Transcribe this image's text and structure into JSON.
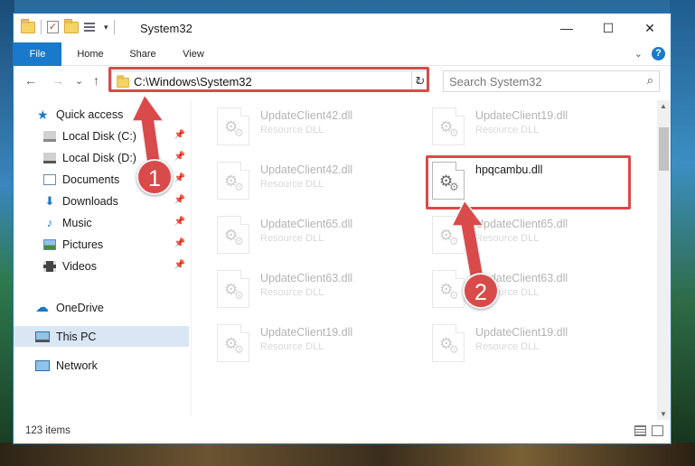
{
  "window": {
    "title": "System32",
    "buttons": {
      "minimize": "—",
      "maximize": "☐",
      "close": "✕"
    }
  },
  "qat": {
    "dropdown": "▾"
  },
  "ribbon": {
    "tabs": [
      "File",
      "Home",
      "Share",
      "View"
    ],
    "expand": "⌄",
    "help": "?"
  },
  "nav": {
    "back": "←",
    "forward": "→",
    "recent": "⌄",
    "up": "↑",
    "address": "C:\\Windows\\System32",
    "address_dropdown": "⌄",
    "refresh": "↻",
    "search_placeholder": "Search System32",
    "search_icon": "search-icon"
  },
  "sidebar": {
    "items": [
      {
        "label": "Quick access",
        "icon": "star-icon",
        "pinned": false,
        "selected": false
      },
      {
        "label": "Local Disk (C:)",
        "icon": "drive-icon",
        "pinned": true,
        "selected": false
      },
      {
        "label": "Local Disk (D:)",
        "icon": "drive-icon",
        "pinned": true,
        "selected": false
      },
      {
        "label": "Documents",
        "icon": "documents-icon",
        "pinned": true,
        "selected": false
      },
      {
        "label": "Downloads",
        "icon": "downloads-icon",
        "pinned": true,
        "selected": false
      },
      {
        "label": "Music",
        "icon": "music-icon",
        "pinned": true,
        "selected": false
      },
      {
        "label": "Pictures",
        "icon": "pictures-icon",
        "pinned": true,
        "selected": false
      },
      {
        "label": "Videos",
        "icon": "videos-icon",
        "pinned": true,
        "selected": false
      },
      {
        "label": "OneDrive",
        "icon": "cloud-icon",
        "pinned": false,
        "selected": false
      },
      {
        "label": "This PC",
        "icon": "computer-icon",
        "pinned": false,
        "selected": true
      },
      {
        "label": "Network",
        "icon": "network-icon",
        "pinned": false,
        "selected": false
      }
    ],
    "pin_glyph": "📌"
  },
  "files": [
    {
      "name": "UpdateClient42.dll",
      "type": "Resource DLL",
      "faded": true
    },
    {
      "name": "UpdateClient19.dll",
      "type": "Resource DLL",
      "faded": true
    },
    {
      "name": "UpdateClient42.dll",
      "type": "Resource DLL",
      "faded": true
    },
    {
      "name": "hpqcambu.dll",
      "type": "",
      "faded": false
    },
    {
      "name": "UpdateClient65.dll",
      "type": "Resource DLL",
      "faded": true
    },
    {
      "name": "UpdateClient65.dll",
      "type": "Resource DLL",
      "faded": true
    },
    {
      "name": "UpdateClient63.dll",
      "type": "Resource DLL",
      "faded": true
    },
    {
      "name": "UpdateClient63.dll",
      "type": "Resource DLL",
      "faded": true
    },
    {
      "name": "UpdateClient19.dll",
      "type": "Resource DLL",
      "faded": true
    },
    {
      "name": "UpdateClient19.dll",
      "type": "Resource DLL",
      "faded": true
    }
  ],
  "status": {
    "item_count": "123 items"
  },
  "callouts": [
    "1",
    "2"
  ],
  "colors": {
    "accent": "#1979ca",
    "highlight": "#d94a4a",
    "selected_bg": "#d9e6f4"
  }
}
